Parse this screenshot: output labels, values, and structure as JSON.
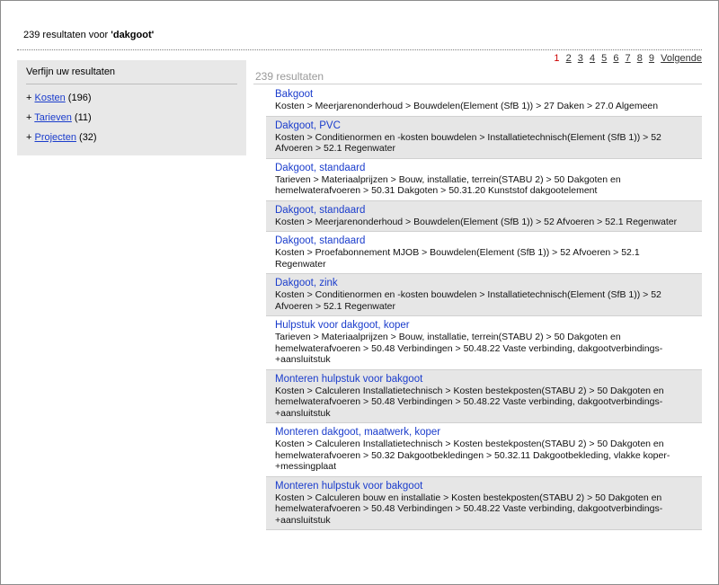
{
  "header": {
    "prefix": "239 resultaten voor",
    "query": "'dakgoot'"
  },
  "sidebar": {
    "title": "Verfijn uw resultaten",
    "facets": [
      {
        "label": "Kosten",
        "count": "(196)"
      },
      {
        "label": "Tarieven",
        "count": "(11)"
      },
      {
        "label": "Projecten",
        "count": "(32)"
      }
    ]
  },
  "results_count": "239 resultaten",
  "pager": {
    "current": "1",
    "pages": [
      "2",
      "3",
      "4",
      "5",
      "6",
      "7",
      "8",
      "9"
    ],
    "next": "Volgende"
  },
  "results": [
    {
      "title": "Bakgoot",
      "path": "Kosten > Meerjarenonderhoud > Bouwdelen(Element (SfB 1)) > 27 Daken > 27.0 Algemeen"
    },
    {
      "title": "Dakgoot, PVC",
      "path": "Kosten > Conditienormen en -kosten bouwdelen > Installatietechnisch(Element (SfB 1)) > 52 Afvoeren > 52.1 Regenwater"
    },
    {
      "title": "Dakgoot, standaard",
      "path": "Tarieven > Materiaalprijzen > Bouw, installatie, terrein(STABU 2) > 50 Dakgoten en hemelwaterafvoeren > 50.31 Dakgoten > 50.31.20 Kunststof dakgootelement"
    },
    {
      "title": "Dakgoot, standaard",
      "path": "Kosten > Meerjarenonderhoud > Bouwdelen(Element (SfB 1)) > 52 Afvoeren > 52.1 Regenwater"
    },
    {
      "title": "Dakgoot, standaard",
      "path": "Kosten > Proefabonnement MJOB > Bouwdelen(Element (SfB 1)) > 52 Afvoeren > 52.1 Regenwater"
    },
    {
      "title": "Dakgoot, zink",
      "path": "Kosten > Conditienormen en -kosten bouwdelen > Installatietechnisch(Element (SfB 1)) > 52 Afvoeren > 52.1 Regenwater"
    },
    {
      "title": "Hulpstuk voor dakgoot, koper",
      "path": "Tarieven > Materiaalprijzen > Bouw, installatie, terrein(STABU 2) > 50 Dakgoten en hemelwaterafvoeren > 50.48 Verbindingen > 50.48.22 Vaste verbinding, dakgootverbindings-+aansluitstuk"
    },
    {
      "title": "Monteren hulpstuk voor bakgoot",
      "path": "Kosten > Calculeren Installatietechnisch > Kosten bestekposten(STABU 2) > 50 Dakgoten en hemelwaterafvoeren > 50.48 Verbindingen > 50.48.22 Vaste verbinding, dakgootverbindings-+aansluitstuk"
    },
    {
      "title": "Monteren dakgoot, maatwerk, koper",
      "path": "Kosten > Calculeren Installatietechnisch > Kosten bestekposten(STABU 2) > 50 Dakgoten en hemelwaterafvoeren > 50.32 Dakgootbekledingen > 50.32.11 Dakgootbekleding, vlakke koper-+messingplaat"
    },
    {
      "title": "Monteren hulpstuk voor bakgoot",
      "path": "Kosten > Calculeren bouw en installatie > Kosten bestekposten(STABU 2) > 50 Dakgoten en hemelwaterafvoeren > 50.48 Verbindingen > 50.48.22 Vaste verbinding, dakgootverbindings-+aansluitstuk"
    }
  ]
}
